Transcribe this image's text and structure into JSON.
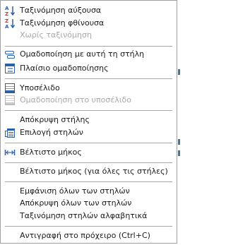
{
  "menu": {
    "items": [
      {
        "label": "Ταξινόμηση αύξουσα",
        "icon": "sort-ascending-icon",
        "enabled": true
      },
      {
        "label": "Ταξινόμηση φθίνουσα",
        "icon": "sort-descending-icon",
        "enabled": true
      },
      {
        "label": "Χωρίς ταξινόμηση",
        "icon": "",
        "enabled": false
      },
      {
        "label": "Ομαδοποίηση με αυτή τη στήλη",
        "icon": "group-by-column-icon",
        "enabled": true
      },
      {
        "label": "Πλαίσιο ομαδοποίησης",
        "icon": "group-box-icon",
        "enabled": true
      },
      {
        "label": "Υποσέλιδο",
        "icon": "footer-icon",
        "enabled": true
      },
      {
        "label": "Ομαδοποίηση στο υποσέλιδο",
        "icon": "group-footer-icon",
        "enabled": false
      },
      {
        "label": "Απόκρυψη στήλης",
        "icon": "",
        "enabled": true
      },
      {
        "label": "Επιλογή στηλών",
        "icon": "column-chooser-icon",
        "enabled": true
      },
      {
        "label": "Βέλτιστο μήκος",
        "icon": "best-fit-icon",
        "enabled": true
      },
      {
        "label": "Βέλτιστο μήκος (για όλες τις στήλες)",
        "icon": "",
        "enabled": true
      },
      {
        "label": "Εμφάνιση όλων των στηλών",
        "icon": "",
        "enabled": true
      },
      {
        "label": "Απόκρυψη όλων των στηλών",
        "icon": "",
        "enabled": true
      },
      {
        "label": "Ταξινόμηση στηλών αλφαβητικά",
        "icon": "",
        "enabled": true
      },
      {
        "label": "Αντιγραφή στο πρόχειρο (Ctrl+C)",
        "icon": "",
        "enabled": true
      }
    ]
  },
  "colors": {
    "text": "#1a1a1a",
    "disabled_text": "#a8a8a8",
    "icon_blue": "#2b5faa",
    "icon_red": "#c0392b",
    "separator": "#a7a7a7"
  }
}
